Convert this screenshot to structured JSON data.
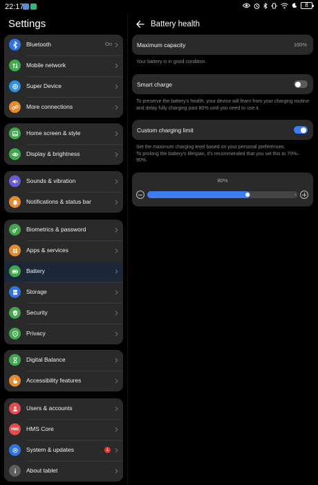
{
  "status_bar": {
    "time": "22:17",
    "battery": "8"
  },
  "settings": {
    "title": "Settings",
    "groups": [
      [
        {
          "id": "bluetooth",
          "label": "Bluetooth",
          "value": "On",
          "icon": "bluetooth-icon",
          "color": "#2f74e6"
        },
        {
          "id": "mobile-network",
          "label": "Mobile network",
          "icon": "mobile-data-icon",
          "color": "#3fa84d"
        },
        {
          "id": "super-device",
          "label": "Super Device",
          "icon": "super-device-icon",
          "color": "#2f8fe0"
        },
        {
          "id": "more-connections",
          "label": "More connections",
          "icon": "link-icon",
          "color": "#e58a2e"
        }
      ],
      [
        {
          "id": "home-screen-style",
          "label": "Home screen & style",
          "icon": "image-icon",
          "color": "#3fa84d"
        },
        {
          "id": "display-brightness",
          "label": "Display & brightness",
          "icon": "eye-icon",
          "color": "#3fa84d"
        }
      ],
      [
        {
          "id": "sounds-vibration",
          "label": "Sounds & vibration",
          "icon": "speaker-icon",
          "color": "#6a5bd6"
        },
        {
          "id": "notifications-status-bar",
          "label": "Notifications & status bar",
          "icon": "bell-icon",
          "color": "#e58a2e"
        }
      ],
      [
        {
          "id": "biometrics-password",
          "label": "Biometrics & password",
          "icon": "key-icon",
          "color": "#3fa84d"
        },
        {
          "id": "apps-services",
          "label": "Apps & services",
          "icon": "apps-grid-icon",
          "color": "#e58a2e"
        },
        {
          "id": "battery",
          "label": "Battery",
          "icon": "battery-icon",
          "color": "#3fa84d",
          "selected": true
        },
        {
          "id": "storage",
          "label": "Storage",
          "icon": "storage-icon",
          "color": "#2f74e6"
        },
        {
          "id": "security",
          "label": "Security",
          "icon": "shield-check-icon",
          "color": "#3fa84d"
        },
        {
          "id": "privacy",
          "label": "Privacy",
          "icon": "privacy-shield-icon",
          "color": "#3fa84d"
        }
      ],
      [
        {
          "id": "digital-balance",
          "label": "Digital Balance",
          "icon": "hourglass-icon",
          "color": "#3fa84d"
        },
        {
          "id": "accessibility-features",
          "label": "Accessibility features",
          "icon": "hand-icon",
          "color": "#e58a2e"
        }
      ],
      [
        {
          "id": "users-accounts",
          "label": "Users & accounts",
          "icon": "user-icon",
          "color": "#e54b4b"
        },
        {
          "id": "hms-core",
          "label": "HMS Core",
          "icon": "hms-logo-icon",
          "color": "#e54b4b",
          "icon_text": "HMS"
        },
        {
          "id": "system-updates",
          "label": "System & updates",
          "icon": "gear-icon",
          "color": "#2f74e6",
          "badge": "1"
        },
        {
          "id": "about-tablet",
          "label": "About tablet",
          "icon": "info-icon",
          "color": "#5e5e5e"
        }
      ]
    ]
  },
  "battery_health": {
    "title": "Battery health",
    "maximum_capacity": {
      "label": "Maximum capacity",
      "value": "100%"
    },
    "condition_note": "Your battery is in good condition.",
    "smart_charge": {
      "label": "Smart charge",
      "enabled": false,
      "note": "To preserve the battery's health, your device will learn from your charging routine and delay fully charging past 80% until you need to use it."
    },
    "custom_charging_limit": {
      "label": "Custom charging limit",
      "enabled": true,
      "note_line1": "Set the maximum charging level based on your personal preferences.",
      "note_line2": "To prolong the battery's lifespan, it's recommended that you set this to 70%–90%."
    },
    "charge_limit_slider": {
      "value_label": "80%",
      "value": 80,
      "min": 40,
      "max": 100
    }
  },
  "colors": {
    "accent": "#3d7cf3",
    "card_bg": "#2a2a2a",
    "selected_row_bg": "#1c2739",
    "badge": "#e53935"
  }
}
